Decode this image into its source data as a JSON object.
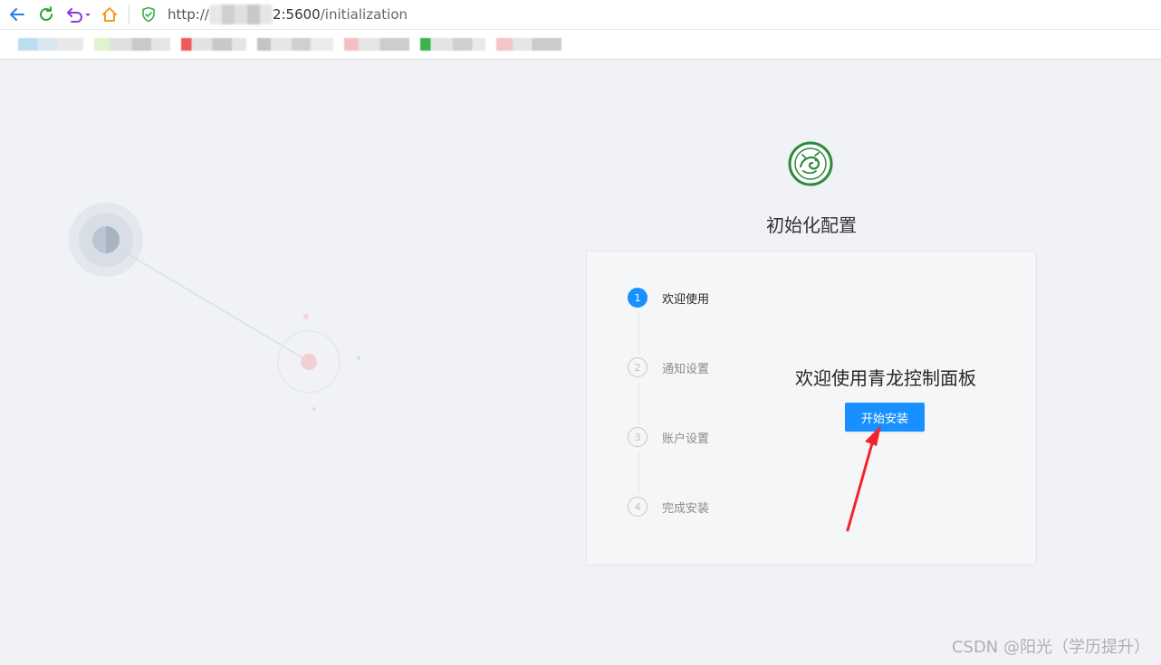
{
  "browser": {
    "url_prefix": "http://",
    "url_host_suffix": "2:5600",
    "url_path": "/initialization",
    "icons": {
      "back": "back-arrow-icon",
      "reload": "reload-icon",
      "undo": "undo-icon",
      "home": "home-icon",
      "secure": "shield-icon"
    }
  },
  "page": {
    "title": "初始化配置",
    "logo": "qinglong-dragon-logo"
  },
  "steps": [
    {
      "number": "1",
      "label": "欢迎使用",
      "state": "active"
    },
    {
      "number": "2",
      "label": "通知设置",
      "state": "wait"
    },
    {
      "number": "3",
      "label": "账户设置",
      "state": "wait"
    },
    {
      "number": "4",
      "label": "完成安装",
      "state": "wait"
    }
  ],
  "content": {
    "welcome_text": "欢迎使用青龙控制面板",
    "start_button": "开始安装"
  },
  "watermark": "CSDN @阳光（学历提升）",
  "colors": {
    "primary": "#1890ff",
    "background": "#f0f2f5",
    "card": "#f5f6f8",
    "logo_green": "#2e8b3e",
    "annotation_arrow": "#f5222d"
  }
}
